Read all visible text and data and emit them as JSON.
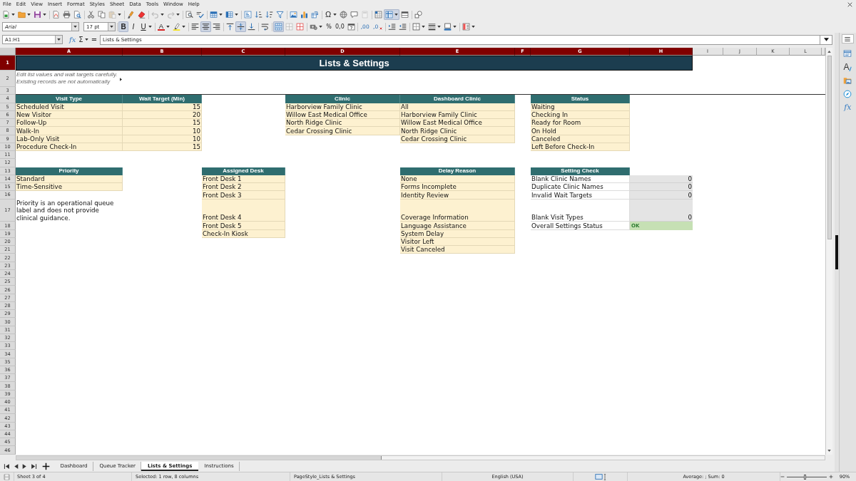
{
  "menu": [
    "File",
    "Edit",
    "View",
    "Insert",
    "Format",
    "Styles",
    "Sheet",
    "Data",
    "Tools",
    "Window",
    "Help"
  ],
  "standard_toolbar": {
    "paste_disabled": true,
    "undo_disabled": true,
    "redo_disabled": true,
    "header_footer_disabled": true,
    "special_character": "Ω",
    "freeze_on": true
  },
  "format_toolbar": {
    "font_name": "Arial",
    "font_size": "17 pt",
    "bold": {
      "label": "B",
      "on": true
    },
    "italic": {
      "label": "I",
      "on": false
    },
    "underline": {
      "label": "U",
      "on": false
    },
    "font_color": "A",
    "align": [
      {
        "kind": "left",
        "selected": false
      },
      {
        "kind": "center",
        "selected": true
      },
      {
        "kind": "right",
        "selected": false
      }
    ],
    "vertical_align": [
      {
        "kind": "top",
        "selected": false
      },
      {
        "kind": "middle",
        "selected": true
      },
      {
        "kind": "bottom",
        "selected": false
      }
    ],
    "wrap_on": false,
    "merge_center_on": true,
    "unmerge_disabled": true,
    "percent": "%",
    "number": "0,0",
    "add_decimal": ",00",
    "delete_decimal": ",0"
  },
  "formula_bar": {
    "name_box": "A1:H1",
    "function_wizard": "fx",
    "sum": "Σ",
    "equals": "=",
    "content": "Lists & Settings"
  },
  "sheet": {
    "columns": [
      {
        "label": "A",
        "selected": true
      },
      {
        "label": "B",
        "selected": true
      },
      {
        "label": "C",
        "selected": true
      },
      {
        "label": "D",
        "selected": true
      },
      {
        "label": "E",
        "selected": true
      },
      {
        "label": "F",
        "selected": true
      },
      {
        "label": "G",
        "selected": true
      },
      {
        "label": "H",
        "selected": true
      },
      {
        "label": "I",
        "selected": false
      },
      {
        "label": "J",
        "selected": false
      },
      {
        "label": "K",
        "selected": false
      },
      {
        "label": "L",
        "selected": false
      }
    ],
    "frozen_rows": [
      {
        "number": "1",
        "selected": true,
        "cells": [
          {
            "kind": "title",
            "text": "Lists & Settings"
          }
        ]
      },
      {
        "number": "2",
        "selected": false,
        "cells": [
          {
            "kind": "note",
            "text": "Edit list values and wait targets carefully. Existing records are not automatically",
            "clipped": true
          }
        ]
      },
      {
        "number": "3",
        "selected": false
      }
    ],
    "rows": [
      {
        "number": "4",
        "selected": false,
        "cells": [
          {
            "kind": "header",
            "text": "Visit Type"
          },
          {
            "kind": "header",
            "text": "Wait Target (Min)"
          },
          {
            "kind": "blank"
          },
          {
            "kind": "header",
            "text": "Clinic"
          },
          {
            "kind": "header",
            "text": "Dashboard Clinic"
          },
          {
            "kind": "blank"
          },
          {
            "kind": "header",
            "text": "Status"
          }
        ]
      },
      {
        "number": "5",
        "selected": false,
        "cells": [
          {
            "kind": "item",
            "text": "Scheduled Visit"
          },
          {
            "kind": "number",
            "text": "15"
          },
          {
            "kind": "blank"
          },
          {
            "kind": "item",
            "text": "Harborview Family Clinic"
          },
          {
            "kind": "item",
            "text": "All"
          },
          {
            "kind": "blank"
          },
          {
            "kind": "item",
            "text": "Waiting"
          }
        ]
      },
      {
        "number": "6",
        "selected": false,
        "cells": [
          {
            "kind": "item",
            "text": "New Visitor"
          },
          {
            "kind": "number",
            "text": "20"
          },
          {
            "kind": "blank"
          },
          {
            "kind": "item",
            "text": "Willow East Medical Office"
          },
          {
            "kind": "item",
            "text": "Harborview Family Clinic"
          },
          {
            "kind": "blank"
          },
          {
            "kind": "item",
            "text": "Checking In"
          }
        ]
      },
      {
        "number": "7",
        "selected": false,
        "cells": [
          {
            "kind": "item",
            "text": "Follow-Up"
          },
          {
            "kind": "number",
            "text": "15"
          },
          {
            "kind": "blank"
          },
          {
            "kind": "item",
            "text": "North Ridge Clinic"
          },
          {
            "kind": "item",
            "text": "Willow East Medical Office"
          },
          {
            "kind": "blank"
          },
          {
            "kind": "item",
            "text": "Ready for Room"
          }
        ]
      },
      {
        "number": "8",
        "selected": false,
        "cells": [
          {
            "kind": "item",
            "text": "Walk-In"
          },
          {
            "kind": "number",
            "text": "10"
          },
          {
            "kind": "blank"
          },
          {
            "kind": "item",
            "text": "Cedar Crossing Clinic"
          },
          {
            "kind": "item",
            "text": "North Ridge Clinic"
          },
          {
            "kind": "blank"
          },
          {
            "kind": "item",
            "text": "On Hold"
          }
        ]
      },
      {
        "number": "9",
        "selected": false,
        "cells": [
          {
            "kind": "item",
            "text": "Lab-Only Visit"
          },
          {
            "kind": "number",
            "text": "10"
          },
          {
            "kind": "blank"
          },
          {
            "kind": "blank"
          },
          {
            "kind": "item",
            "text": "Cedar Crossing Clinic"
          },
          {
            "kind": "blank"
          },
          {
            "kind": "item",
            "text": "Canceled"
          }
        ]
      },
      {
        "number": "10",
        "selected": false,
        "cells": [
          {
            "kind": "item",
            "text": "Procedure Check-In"
          },
          {
            "kind": "number",
            "text": "15"
          },
          {
            "kind": "blank"
          },
          {
            "kind": "blank"
          },
          {
            "kind": "blank"
          },
          {
            "kind": "blank"
          },
          {
            "kind": "item",
            "text": "Left Before Check-In"
          }
        ]
      },
      {
        "number": "11",
        "selected": false
      },
      {
        "number": "12",
        "selected": false
      },
      {
        "number": "13",
        "selected": false,
        "cells": [
          {
            "kind": "header",
            "text": "Priority"
          },
          {
            "kind": "blank"
          },
          {
            "kind": "header",
            "text": "Assigned Desk"
          },
          {
            "kind": "blank"
          },
          {
            "kind": "header",
            "text": "Delay Reason"
          },
          {
            "kind": "blank"
          },
          {
            "kind": "header",
            "text": "Setting Check"
          }
        ]
      },
      {
        "number": "14",
        "selected": false,
        "cells": [
          {
            "kind": "item",
            "text": "Standard"
          },
          {
            "kind": "blank"
          },
          {
            "kind": "item",
            "text": "Front Desk 1"
          },
          {
            "kind": "blank"
          },
          {
            "kind": "item",
            "text": "None"
          },
          {
            "kind": "blank"
          },
          {
            "kind": "label",
            "text": "Blank Clinic Names"
          },
          {
            "kind": "count",
            "text": "0"
          }
        ]
      },
      {
        "number": "15",
        "selected": false,
        "cells": [
          {
            "kind": "item",
            "text": "Time-Sensitive"
          },
          {
            "kind": "blank"
          },
          {
            "kind": "item",
            "text": "Front Desk 2"
          },
          {
            "kind": "blank"
          },
          {
            "kind": "item",
            "text": "Forms Incomplete"
          },
          {
            "kind": "blank"
          },
          {
            "kind": "label",
            "text": "Duplicate Clinic Names"
          },
          {
            "kind": "count",
            "text": "0"
          }
        ]
      },
      {
        "number": "16",
        "selected": false,
        "cells": [
          {
            "kind": "blank"
          },
          {
            "kind": "blank"
          },
          {
            "kind": "item",
            "text": "Front Desk 3"
          },
          {
            "kind": "blank"
          },
          {
            "kind": "item",
            "text": "Identity Review"
          },
          {
            "kind": "blank"
          },
          {
            "kind": "label",
            "text": "Invalid Wait Targets"
          },
          {
            "kind": "count",
            "text": "0"
          }
        ]
      },
      {
        "number": "17",
        "selected": false,
        "cells": [
          {
            "kind": "text",
            "text": "Priority is an operational queue label and does not provide clinical guidance."
          },
          {
            "kind": "blank"
          },
          {
            "kind": "item",
            "text": "Front Desk 4"
          },
          {
            "kind": "blank"
          },
          {
            "kind": "item",
            "text": "Coverage Information"
          },
          {
            "kind": "blank"
          },
          {
            "kind": "label",
            "text": "Blank Visit Types"
          },
          {
            "kind": "count",
            "text": "0"
          }
        ]
      },
      {
        "number": "18",
        "selected": false,
        "cells": [
          {
            "kind": "blank"
          },
          {
            "kind": "blank"
          },
          {
            "kind": "item",
            "text": "Front Desk 5"
          },
          {
            "kind": "blank"
          },
          {
            "kind": "item",
            "text": "Language Assistance"
          },
          {
            "kind": "blank"
          },
          {
            "kind": "label",
            "text": "Overall Settings Status"
          },
          {
            "kind": "status",
            "text": "OK"
          }
        ]
      },
      {
        "number": "19",
        "selected": false,
        "cells": [
          {
            "kind": "blank"
          },
          {
            "kind": "blank"
          },
          {
            "kind": "item",
            "text": "Check-In Kiosk"
          },
          {
            "kind": "blank"
          },
          {
            "kind": "item",
            "text": "System Delay"
          }
        ]
      },
      {
        "number": "20",
        "selected": false,
        "cells": [
          {
            "kind": "blank"
          },
          {
            "kind": "blank"
          },
          {
            "kind": "blank"
          },
          {
            "kind": "blank"
          },
          {
            "kind": "item",
            "text": "Visitor Left"
          }
        ]
      },
      {
        "number": "21",
        "selected": false,
        "cells": [
          {
            "kind": "blank"
          },
          {
            "kind": "blank"
          },
          {
            "kind": "blank"
          },
          {
            "kind": "blank"
          },
          {
            "kind": "item",
            "text": "Visit Canceled"
          }
        ]
      },
      {
        "number": "22",
        "selected": false
      },
      {
        "number": "23",
        "selected": false
      },
      {
        "number": "24",
        "selected": false
      },
      {
        "number": "25",
        "selected": false
      },
      {
        "number": "26",
        "selected": false
      },
      {
        "number": "27",
        "selected": false
      },
      {
        "number": "28",
        "selected": false
      },
      {
        "number": "29",
        "selected": false
      },
      {
        "number": "30",
        "selected": false
      },
      {
        "number": "31",
        "selected": false
      },
      {
        "number": "32",
        "selected": false
      },
      {
        "number": "33",
        "selected": false
      },
      {
        "number": "34",
        "selected": false
      },
      {
        "number": "35",
        "selected": false
      },
      {
        "number": "36",
        "selected": false
      },
      {
        "number": "37",
        "selected": false
      },
      {
        "number": "38",
        "selected": false
      },
      {
        "number": "39",
        "selected": false
      },
      {
        "number": "40",
        "selected": false
      },
      {
        "number": "41",
        "selected": false
      },
      {
        "number": "42",
        "selected": false
      },
      {
        "number": "43",
        "selected": false
      },
      {
        "number": "44",
        "selected": false
      },
      {
        "number": "45",
        "selected": false
      },
      {
        "number": "46",
        "selected": false
      }
    ]
  },
  "sheet_tabs": [
    {
      "label": "Dashboard",
      "selected": false
    },
    {
      "label": "Queue Tracker",
      "selected": false
    },
    {
      "label": "Lists & Settings",
      "selected": true
    },
    {
      "label": "Instructions",
      "selected": false
    }
  ],
  "sidebar": {
    "styles_glyph": "A",
    "functions_glyph": "fx"
  },
  "status_bar": {
    "sheet": "Sheet 3 of 4",
    "selection": "Selected: 1 row, 8 columns",
    "page_style": "PageStyle_Lists & Settings",
    "language": "English (USA)",
    "sum": "Average: ; Sum: 0",
    "zoom_slider": {
      "level": 0.45
    },
    "zoom": "90%"
  }
}
